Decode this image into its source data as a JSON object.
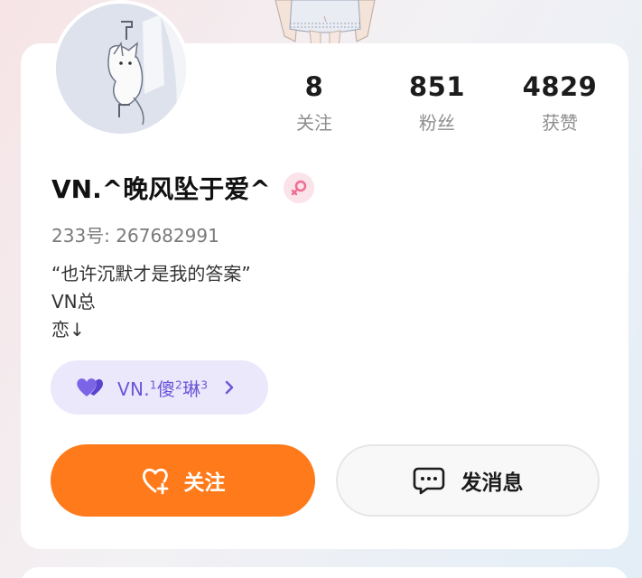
{
  "profile": {
    "username": "VN.^晚风坠于爱^",
    "uid_text": "233号: 267682991",
    "bio": [
      "“也许沉默才是我的答案”",
      "VN总",
      "恋↓"
    ]
  },
  "stats": [
    {
      "value": "8",
      "label": "关注"
    },
    {
      "value": "851",
      "label": "粉丝"
    },
    {
      "value": "4829",
      "label": "获赞"
    }
  ],
  "relation": {
    "prefix": "VN.",
    "sup1": "1",
    "char1": "傻",
    "sup2": "2",
    "char2": "琳",
    "sup3": "3"
  },
  "actions": {
    "follow_label": "关注",
    "message_label": "发消息"
  },
  "icons": {
    "gender": "female-symbol-icon",
    "relation": "double-heart-icon",
    "chevron": "chevron-right-icon",
    "follow": "heart-plus-icon",
    "message": "chat-bubble-icon"
  },
  "colors": {
    "accent": "#ff7a1a",
    "relation_text": "#6a55d9",
    "relation_bg": "#ebe8fb",
    "gender": "#f06a92"
  }
}
